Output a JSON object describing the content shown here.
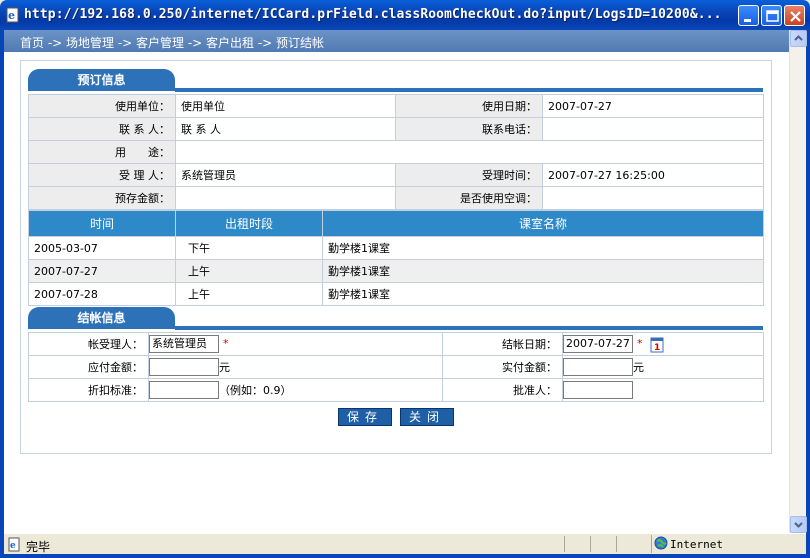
{
  "window": {
    "title": "http://192.168.0.250/internet/ICCard.prField.classRoomCheckOut.do?input/LogsID=10200&..."
  },
  "breadcrumb": "首页 -> 场地管理 -> 客户管理 -> 客户出租 -> 预订结帐",
  "booking_section": {
    "title": "预订信息"
  },
  "booking_info": {
    "unit_label": "使用单位：",
    "unit_value": "使用单位",
    "date_label": "使用日期：",
    "date_value": "2007-07-27",
    "contact_label": "联 系 人：",
    "contact_value": "联 系 人",
    "phone_label": "联系电话：",
    "phone_value": "",
    "purpose_label": "用　　途：",
    "purpose_value": "",
    "handler_label": "受 理 人：",
    "handler_value": "系统管理员",
    "handle_time_label": "受理时间：",
    "handle_time_value": "2007-07-27 16:25:00",
    "deposit_label": "预存金额：",
    "deposit_value": "",
    "ac_label": "是否使用空调：",
    "ac_value": ""
  },
  "schedule": {
    "headers": [
      "时间",
      "出租时段",
      "课室名称"
    ],
    "rows": [
      [
        "2005-03-07",
        "下午",
        "勤学楼1课室"
      ],
      [
        "2007-07-27",
        "上午",
        "勤学楼1课室"
      ],
      [
        "2007-07-28",
        "上午",
        "勤学楼1课室"
      ]
    ]
  },
  "checkout_section": {
    "title": "结帐信息"
  },
  "checkout_form": {
    "handler_label": "帐受理人：",
    "handler_value": "系统管理员",
    "date_label": "结帐日期：",
    "date_value": "2007-07-27",
    "payable_label": "应付金额：",
    "payable_value": "",
    "payable_unit": "元",
    "paid_label": "实付金额：",
    "paid_value": "",
    "paid_unit": "元",
    "discount_label": "折扣标准：",
    "discount_value": "",
    "discount_hint": "（例如：0.9）",
    "approver_label": "批准人：",
    "approver_value": "",
    "required_mark": "*"
  },
  "buttons": {
    "save": "保存",
    "close": "关闭"
  },
  "status": {
    "text": "完毕",
    "zone": "Internet"
  },
  "icons": [
    "ie-page-icon",
    "minimize-icon",
    "maximize-icon",
    "close-icon",
    "calendar-icon",
    "scroll-up-icon",
    "scroll-down-icon",
    "globe-icon"
  ],
  "colors": {
    "section_blue": "#2d72b8",
    "table_header": "#2d89c8",
    "breadcrumb_bg": "#5a83bb",
    "required": "#dd0000"
  }
}
